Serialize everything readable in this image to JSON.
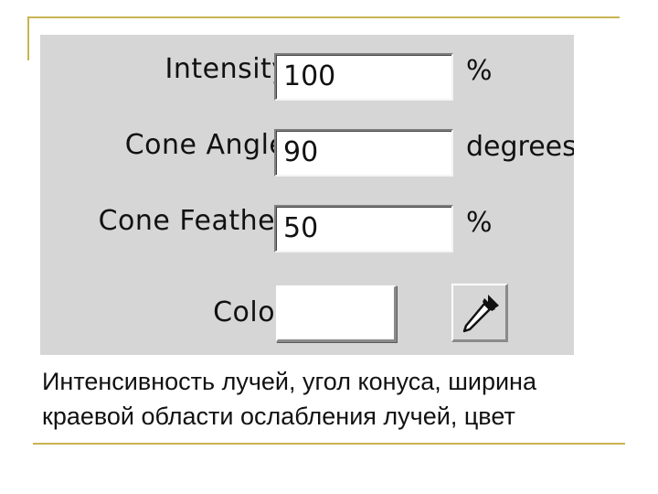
{
  "dialog": {
    "fields": [
      {
        "label": "Intensity:",
        "value": "100",
        "unit": "%"
      },
      {
        "label": "Cone Angle:",
        "value": "90",
        "unit": "degrees"
      },
      {
        "label": "Cone Feather:",
        "value": "50",
        "unit": "%"
      }
    ],
    "color": {
      "label": "Color:",
      "swatch": "#ffffff",
      "picker_icon": "eyedropper-icon"
    }
  },
  "caption": {
    "line1": "Интенсивность лучей, угол конуса, ширина",
    "line2": "краевой области ослабления лучей, цвет"
  },
  "colors": {
    "accent_line": "#c8b451",
    "panel": "#d6d6d6"
  }
}
